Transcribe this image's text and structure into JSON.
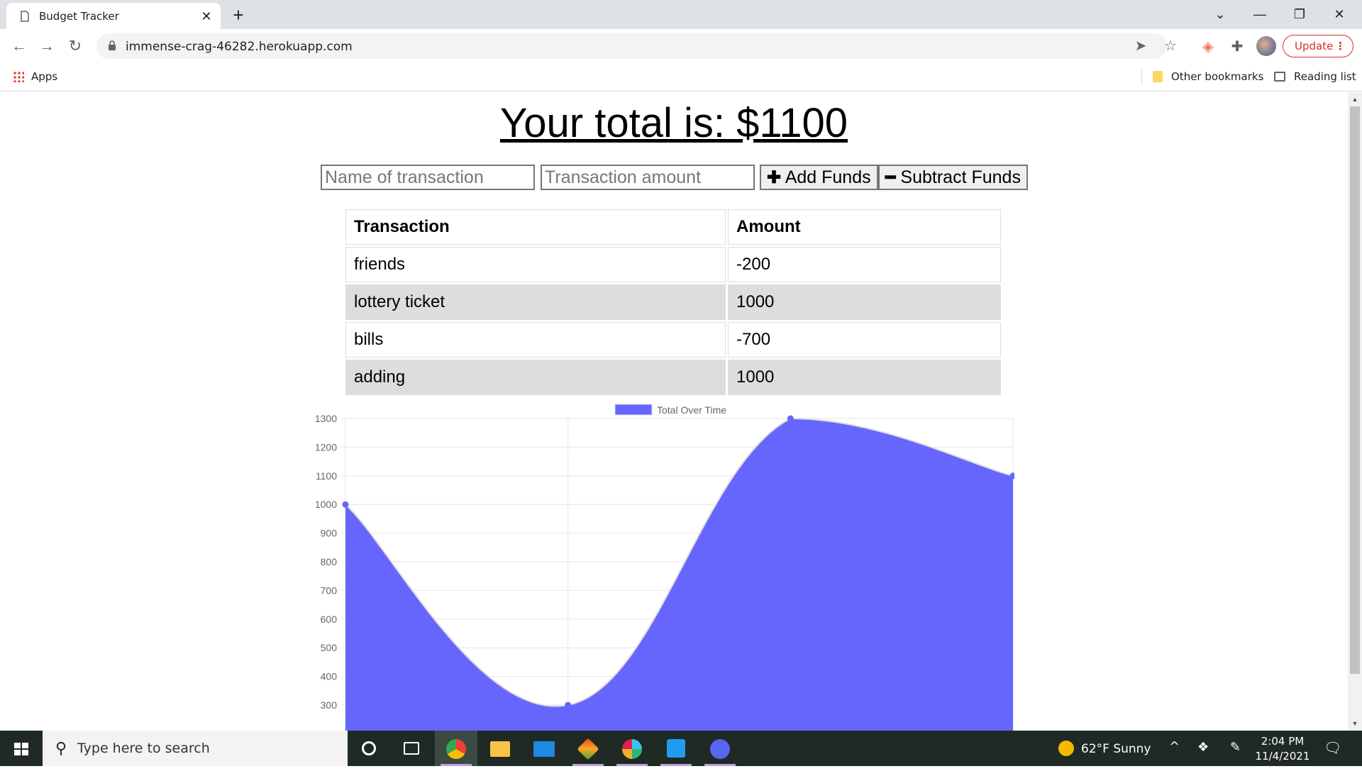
{
  "browser": {
    "tab_title": "Budget Tracker",
    "url": "immense-crag-46282.herokuapp.com",
    "update_label": "Update",
    "bookmarks": {
      "apps": "Apps",
      "other": "Other bookmarks",
      "reading": "Reading list"
    }
  },
  "page": {
    "total_text": "Your total is: $1100",
    "name_placeholder": "Name of transaction",
    "amount_placeholder": "Transaction amount",
    "add_label": "Add Funds",
    "subtract_label": "Subtract Funds",
    "table": {
      "headers": [
        "Transaction",
        "Amount"
      ],
      "rows": [
        {
          "name": "friends",
          "amount": "-200"
        },
        {
          "name": "lottery ticket",
          "amount": "1000"
        },
        {
          "name": "bills",
          "amount": "-700"
        },
        {
          "name": "adding",
          "amount": "1000"
        }
      ]
    }
  },
  "chart_data": {
    "type": "area",
    "series": [
      {
        "name": "Total Over Time",
        "values": [
          1000,
          300,
          1300,
          1100
        ]
      }
    ],
    "x": [
      0,
      1,
      2,
      3
    ],
    "yticks": [
      300,
      400,
      500,
      600,
      700,
      800,
      900,
      1000,
      1100,
      1200,
      1300
    ],
    "ylim": [
      300,
      1300
    ],
    "fill_color": "#6666ff",
    "line_color": "#dddddd",
    "grid": true,
    "legend": "top"
  },
  "taskbar": {
    "search_placeholder": "Type here to search",
    "weather": "62°F  Sunny",
    "time": "2:04 PM",
    "date": "11/4/2021"
  }
}
